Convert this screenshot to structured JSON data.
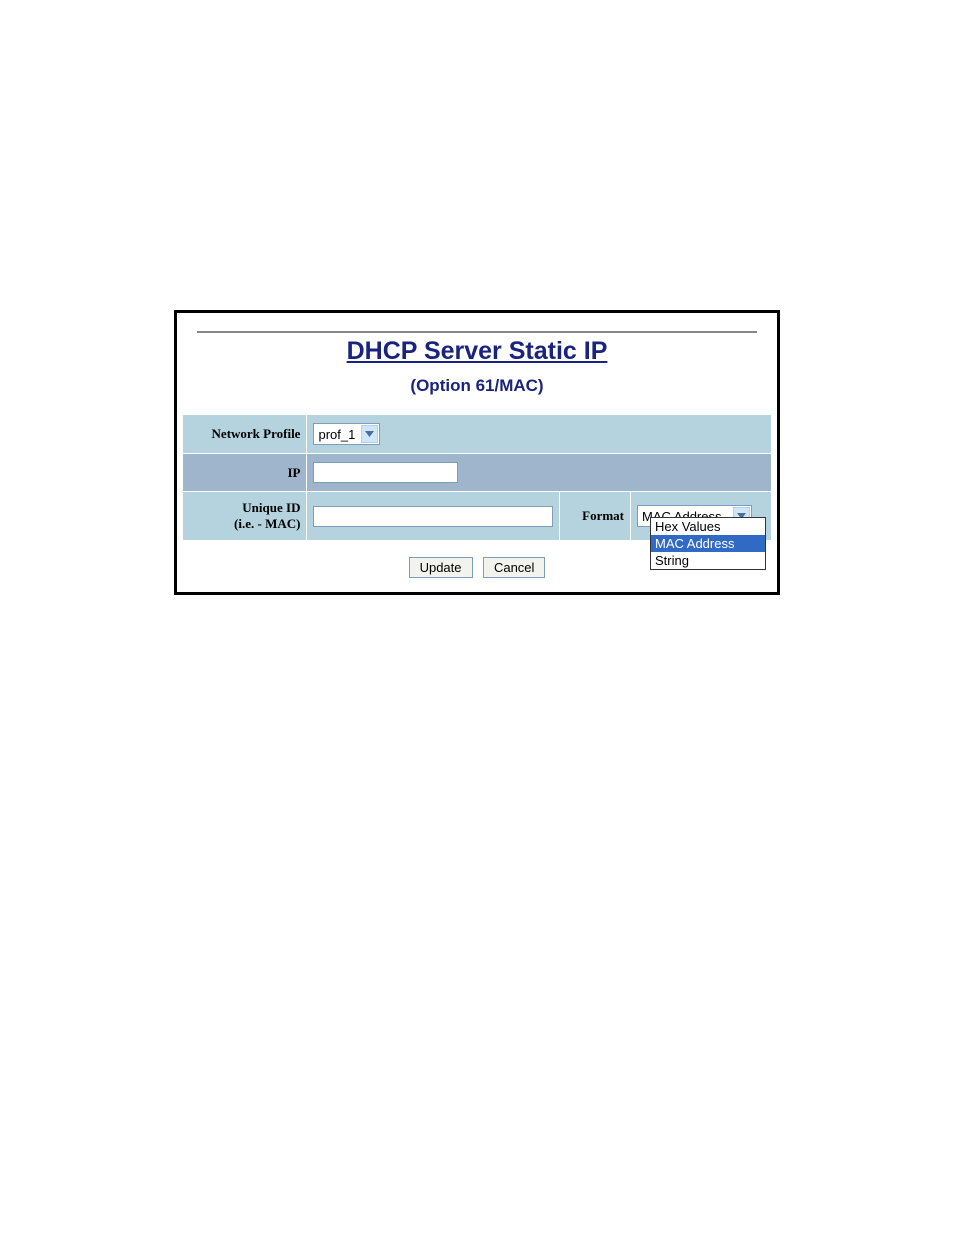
{
  "title": "DHCP Server Static IP",
  "subtitle": "(Option 61/MAC)",
  "labels": {
    "network_profile": "Network Profile",
    "ip": "IP",
    "unique_id_line1": "Unique ID",
    "unique_id_line2": "(i.e. - MAC)",
    "format": "Format"
  },
  "fields": {
    "network_profile_selected": "prof_1",
    "ip_value": "",
    "unique_id_value": "",
    "format_selected": "MAC Address"
  },
  "format_options": {
    "opt0": "Hex Values",
    "opt1": "MAC Address",
    "opt2": "String"
  },
  "buttons": {
    "update": "Update",
    "cancel": "Cancel"
  }
}
